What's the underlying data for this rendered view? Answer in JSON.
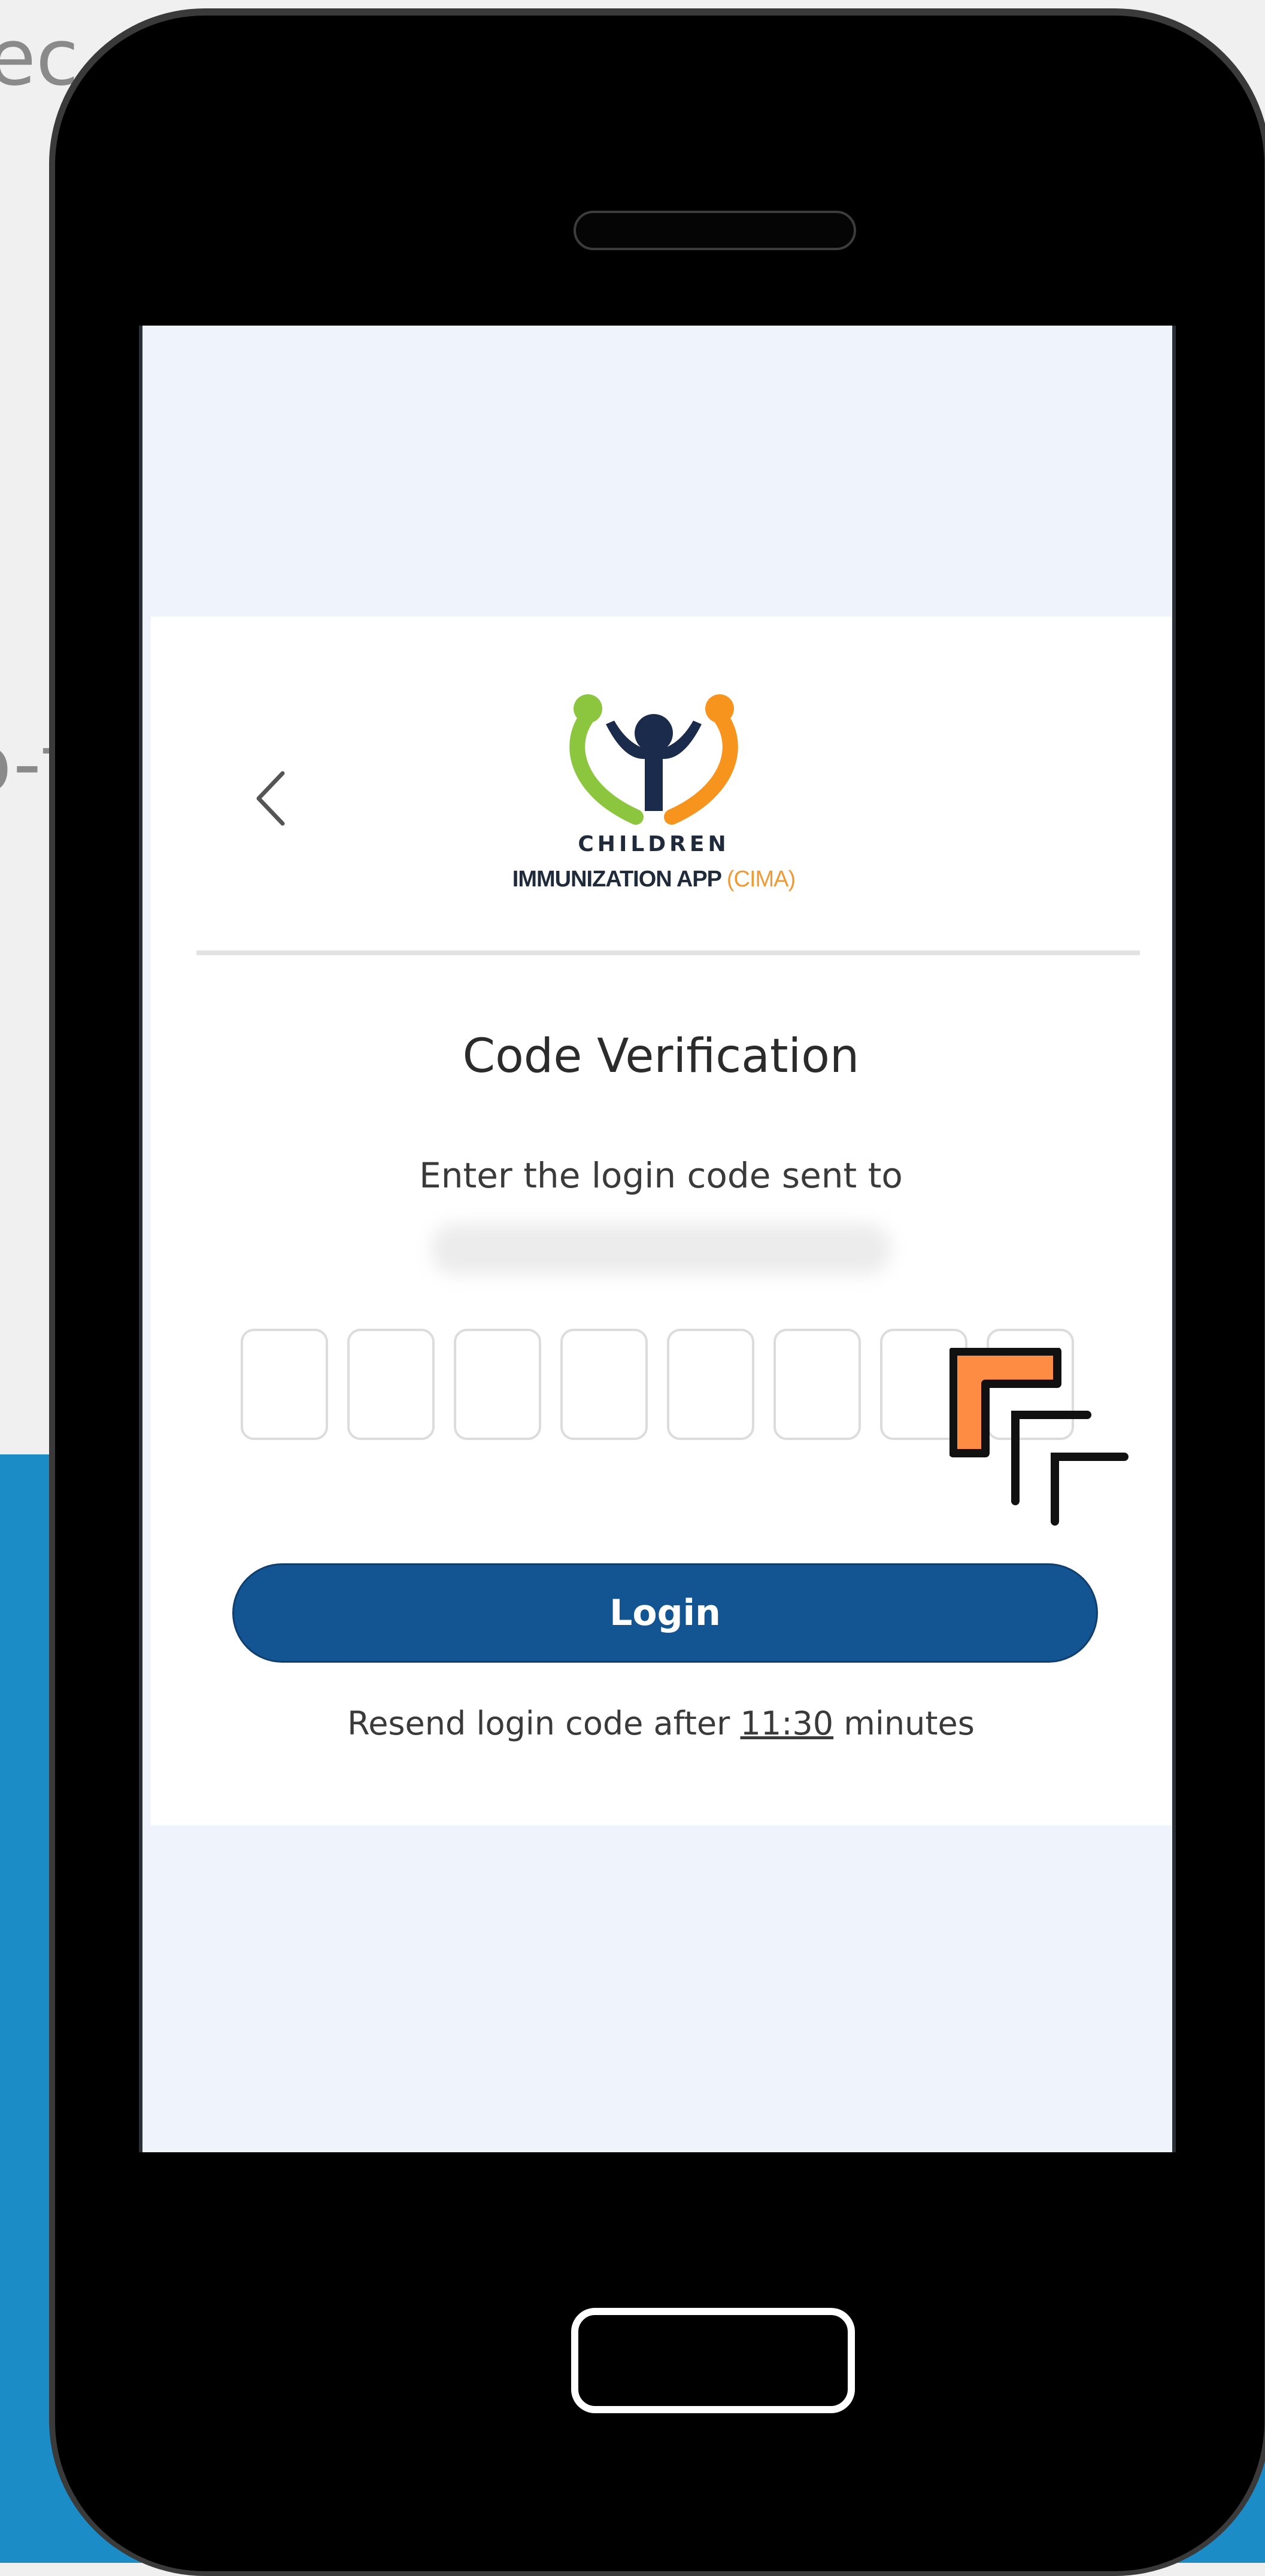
{
  "background": {
    "text_top": "ec",
    "text_mid": "o-f"
  },
  "header": {
    "back_icon": "chevron-left-icon",
    "logo": {
      "line1": "CHILDREN",
      "line2_main": "IMMUNIZATION APP",
      "line2_accent": "(CIMA)",
      "colors": {
        "green": "#8cc63f",
        "orange": "#f7941d",
        "navy": "#1b2b4b"
      }
    }
  },
  "verification": {
    "title": "Code Verification",
    "subtitle": "Enter the login code sent to",
    "code_boxes": 8,
    "login_label": "Login",
    "resend_prefix": "Resend login code after",
    "resend_timer": "11:30",
    "resend_suffix": "minutes"
  },
  "colors": {
    "primary": "#135493",
    "screen_bg": "#eff4fc",
    "page_blue": "#1b8cc6",
    "accent_orange": "#ff8c42"
  }
}
